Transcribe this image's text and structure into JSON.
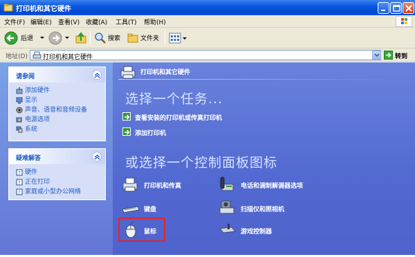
{
  "window": {
    "title": "打印机和其它硬件"
  },
  "menu": [
    "文件(F)",
    "编辑(E)",
    "查看(V)",
    "收藏(A)",
    "工具(T)",
    "帮助(H)"
  ],
  "toolbar": {
    "back": "后退",
    "search": "搜索",
    "folders": "文件夹"
  },
  "address": {
    "label": "地址(D)",
    "value": "打印机和其它硬件",
    "go": "转到"
  },
  "see_also": {
    "title": "请参阅",
    "items": [
      "添加硬件",
      "显示",
      "声音、语音和音频设备",
      "电源选项",
      "系统"
    ]
  },
  "troubleshooters": {
    "title": "疑难解答",
    "items": [
      "硬件",
      "正在打印",
      "家庭或小型办公网络"
    ]
  },
  "main": {
    "header": "打印机和其它硬件",
    "pick_task": "选择一个任务...",
    "tasks": [
      "查看安装的打印机或传真打印机",
      "添加打印机"
    ],
    "pick_icon": "或选择一个控制面板图标",
    "icons": [
      {
        "label": "打印机和传真",
        "icon": "printer-fax-icon"
      },
      {
        "label": "电话和调制解调器选项",
        "icon": "phone-modem-icon"
      },
      {
        "label": "键盘",
        "icon": "keyboard-icon"
      },
      {
        "label": "扫描仪和照相机",
        "icon": "scanner-camera-icon"
      },
      {
        "label": "鼠标",
        "icon": "mouse-icon"
      },
      {
        "label": "游戏控制器",
        "icon": "game-controller-icon"
      }
    ]
  },
  "colors": {
    "title_bar": "#0a58df",
    "panel": "#7ba2e7",
    "main_bg": "#5b72d4",
    "highlight": "#e0262b"
  }
}
